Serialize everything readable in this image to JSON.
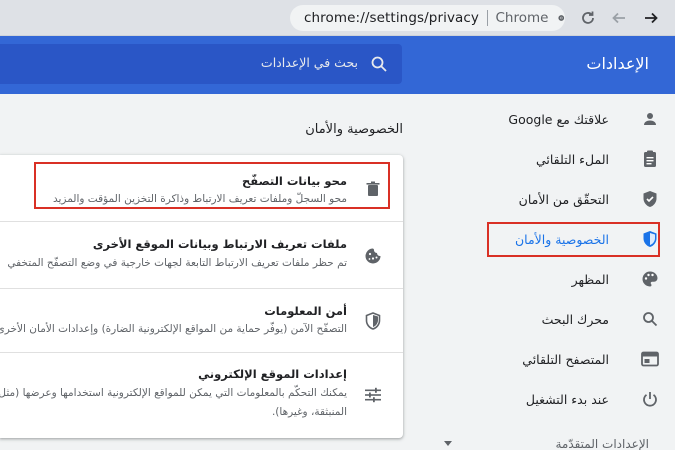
{
  "browser": {
    "url": "chrome://settings/privacy",
    "app_name": "Chrome"
  },
  "header": {
    "title": "الإعدادات",
    "search_placeholder": "بحث في الإعدادات"
  },
  "sidebar": {
    "items": [
      {
        "label": "علاقتك مع Google",
        "icon": "person-icon"
      },
      {
        "label": "الملء التلقائي",
        "icon": "clipboard-icon"
      },
      {
        "label": "التحقّق من الأمان",
        "icon": "shield-check-icon"
      },
      {
        "label": "الخصوصية والأمان",
        "icon": "shield-privacy-icon",
        "active": true
      },
      {
        "label": "المظهر",
        "icon": "palette-icon"
      },
      {
        "label": "محرك البحث",
        "icon": "search-icon"
      },
      {
        "label": "المتصفح التلقائي",
        "icon": "browser-icon"
      },
      {
        "label": "عند بدء التشغيل",
        "icon": "power-icon"
      }
    ],
    "advanced_label": "الإعدادات المتقدّمة"
  },
  "main": {
    "section_title": "الخصوصية والأمان",
    "rows": [
      {
        "title": "محو بيانات التصفّح",
        "desc": "محو السجلّ وملفات تعريف الارتباط وذاكرة التخزين المؤقت والمزيد",
        "desc2": "",
        "icon": "trash-icon"
      },
      {
        "title": "ملفات تعريف الارتباط وبيانات الموقع الأخرى",
        "desc": "تم حظر ملفات تعريف الارتباط التابعة لجهات خارجية في وضع التصفّح المتخفي",
        "desc2": "",
        "icon": "cookie-icon"
      },
      {
        "title": "أمن المعلومات",
        "desc": "التصفّح الآمن (يوفّر حماية من المواقع الإلكترونية الضارة) وإعدادات الأمان الأخرى",
        "desc2": "",
        "icon": "security-shield-icon"
      },
      {
        "title": "إعدادات الموقع الإلكتروني",
        "desc": "يمكنك التحكّم بالمعلومات التي يمكن للمواقع الإلكترونية استخدامها وعرضها (مثل معلومات",
        "desc2": "المنبثقة، وغيرها).",
        "icon": "tune-icon"
      }
    ]
  },
  "colors": {
    "accent": "#1a73e8",
    "header_bg": "#3367d6",
    "highlight": "#d93025"
  }
}
